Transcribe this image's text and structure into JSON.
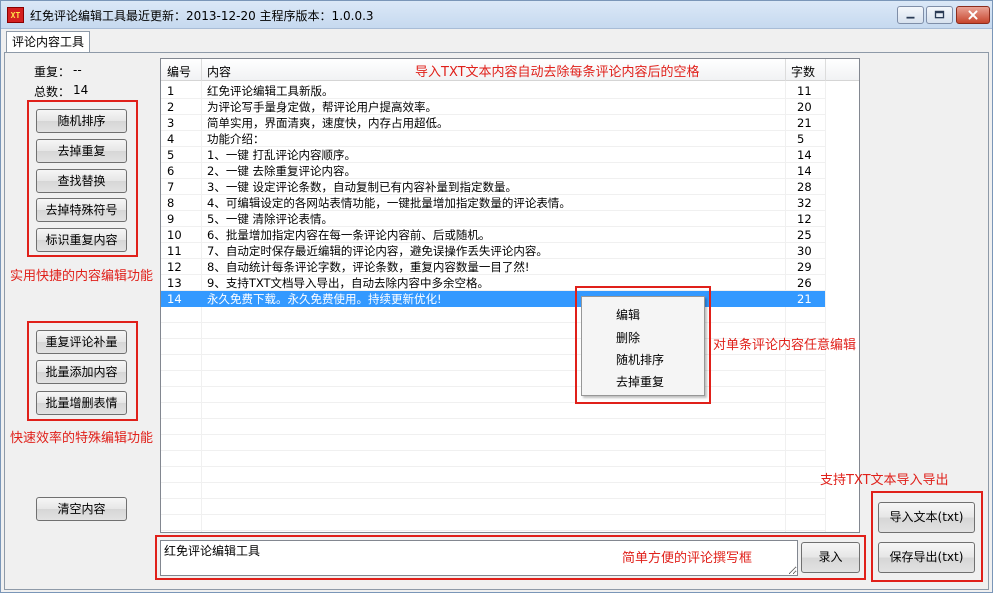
{
  "window": {
    "title": "红免评论编辑工具最近更新：2013-12-20  主程序版本：1.0.0.3",
    "icon_text": "XT"
  },
  "tab": {
    "label": "评论内容工具"
  },
  "stats": {
    "duplicate_label": "重复：",
    "duplicate_value": "--",
    "total_label": "总数：",
    "total_value": "14"
  },
  "buttons": {
    "random_sort": "随机排序",
    "remove_duplicates": "去掉重复",
    "find_replace": "查找替换",
    "remove_special": "去掉特殊符号",
    "mark_duplicates": "标识重复内容",
    "repeat_fill": "重复评论补量",
    "batch_add": "批量添加内容",
    "batch_emoji": "批量增删表情",
    "clear": "清空内容",
    "record": "录入",
    "import": "导入文本(txt)",
    "export": "保存导出(txt)"
  },
  "table": {
    "columns": {
      "num": "编号",
      "content": "内容",
      "count": "字数"
    },
    "rows": [
      {
        "num": "1",
        "content": "红免评论编辑工具新版。",
        "count": "11"
      },
      {
        "num": "2",
        "content": "为评论写手量身定做，帮评论用户提高效率。",
        "count": "20"
      },
      {
        "num": "3",
        "content": "简单实用，界面清爽，速度快，内存占用超低。",
        "count": "21"
      },
      {
        "num": "4",
        "content": "功能介绍：",
        "count": "5"
      },
      {
        "num": "5",
        "content": "1、一键 打乱评论内容顺序。",
        "count": "14"
      },
      {
        "num": "6",
        "content": "2、一键 去除重复评论内容。",
        "count": "14"
      },
      {
        "num": "7",
        "content": "3、一键 设定评论条数，自动复制已有内容补量到指定数量。",
        "count": "28"
      },
      {
        "num": "8",
        "content": "4、可编辑设定的各网站表情功能，一键批量增加指定数量的评论表情。",
        "count": "32"
      },
      {
        "num": "9",
        "content": "5、一键 清除评论表情。",
        "count": "12"
      },
      {
        "num": "10",
        "content": "6、批量增加指定内容在每一条评论内容前、后或随机。",
        "count": "25"
      },
      {
        "num": "11",
        "content": "7、自动定时保存最近编辑的评论内容，避免误操作丢失评论内容。",
        "count": "30"
      },
      {
        "num": "12",
        "content": "8、自动统计每条评论字数，评论条数，重复内容数量一目了然!",
        "count": "29"
      },
      {
        "num": "13",
        "content": "9、支持TXT文档导入导出，自动去除内容中多余空格。",
        "count": "26"
      },
      {
        "num": "14",
        "content": "永久免费下载。永久免费使用。持续更新优化!",
        "count": "21"
      }
    ]
  },
  "context_menu": {
    "items": [
      "编辑",
      "删除",
      "随机排序",
      "去掉重复"
    ]
  },
  "input": {
    "value": "红免评论编辑工具"
  },
  "annotations": {
    "txt_import": "导入TXT文本内容自动去除每条评论内容后的空格",
    "content_edit": "实用快捷的内容编辑功能",
    "special_edit": "快速效率的特殊编辑功能",
    "single_edit": "对单条评论内容任意编辑",
    "txt_support": "支持TXT文本导入导出",
    "compose_box": "简单方便的评论撰写框"
  },
  "colors": {
    "annotation_red": "#e0201a",
    "selection_blue": "#3399ff"
  }
}
